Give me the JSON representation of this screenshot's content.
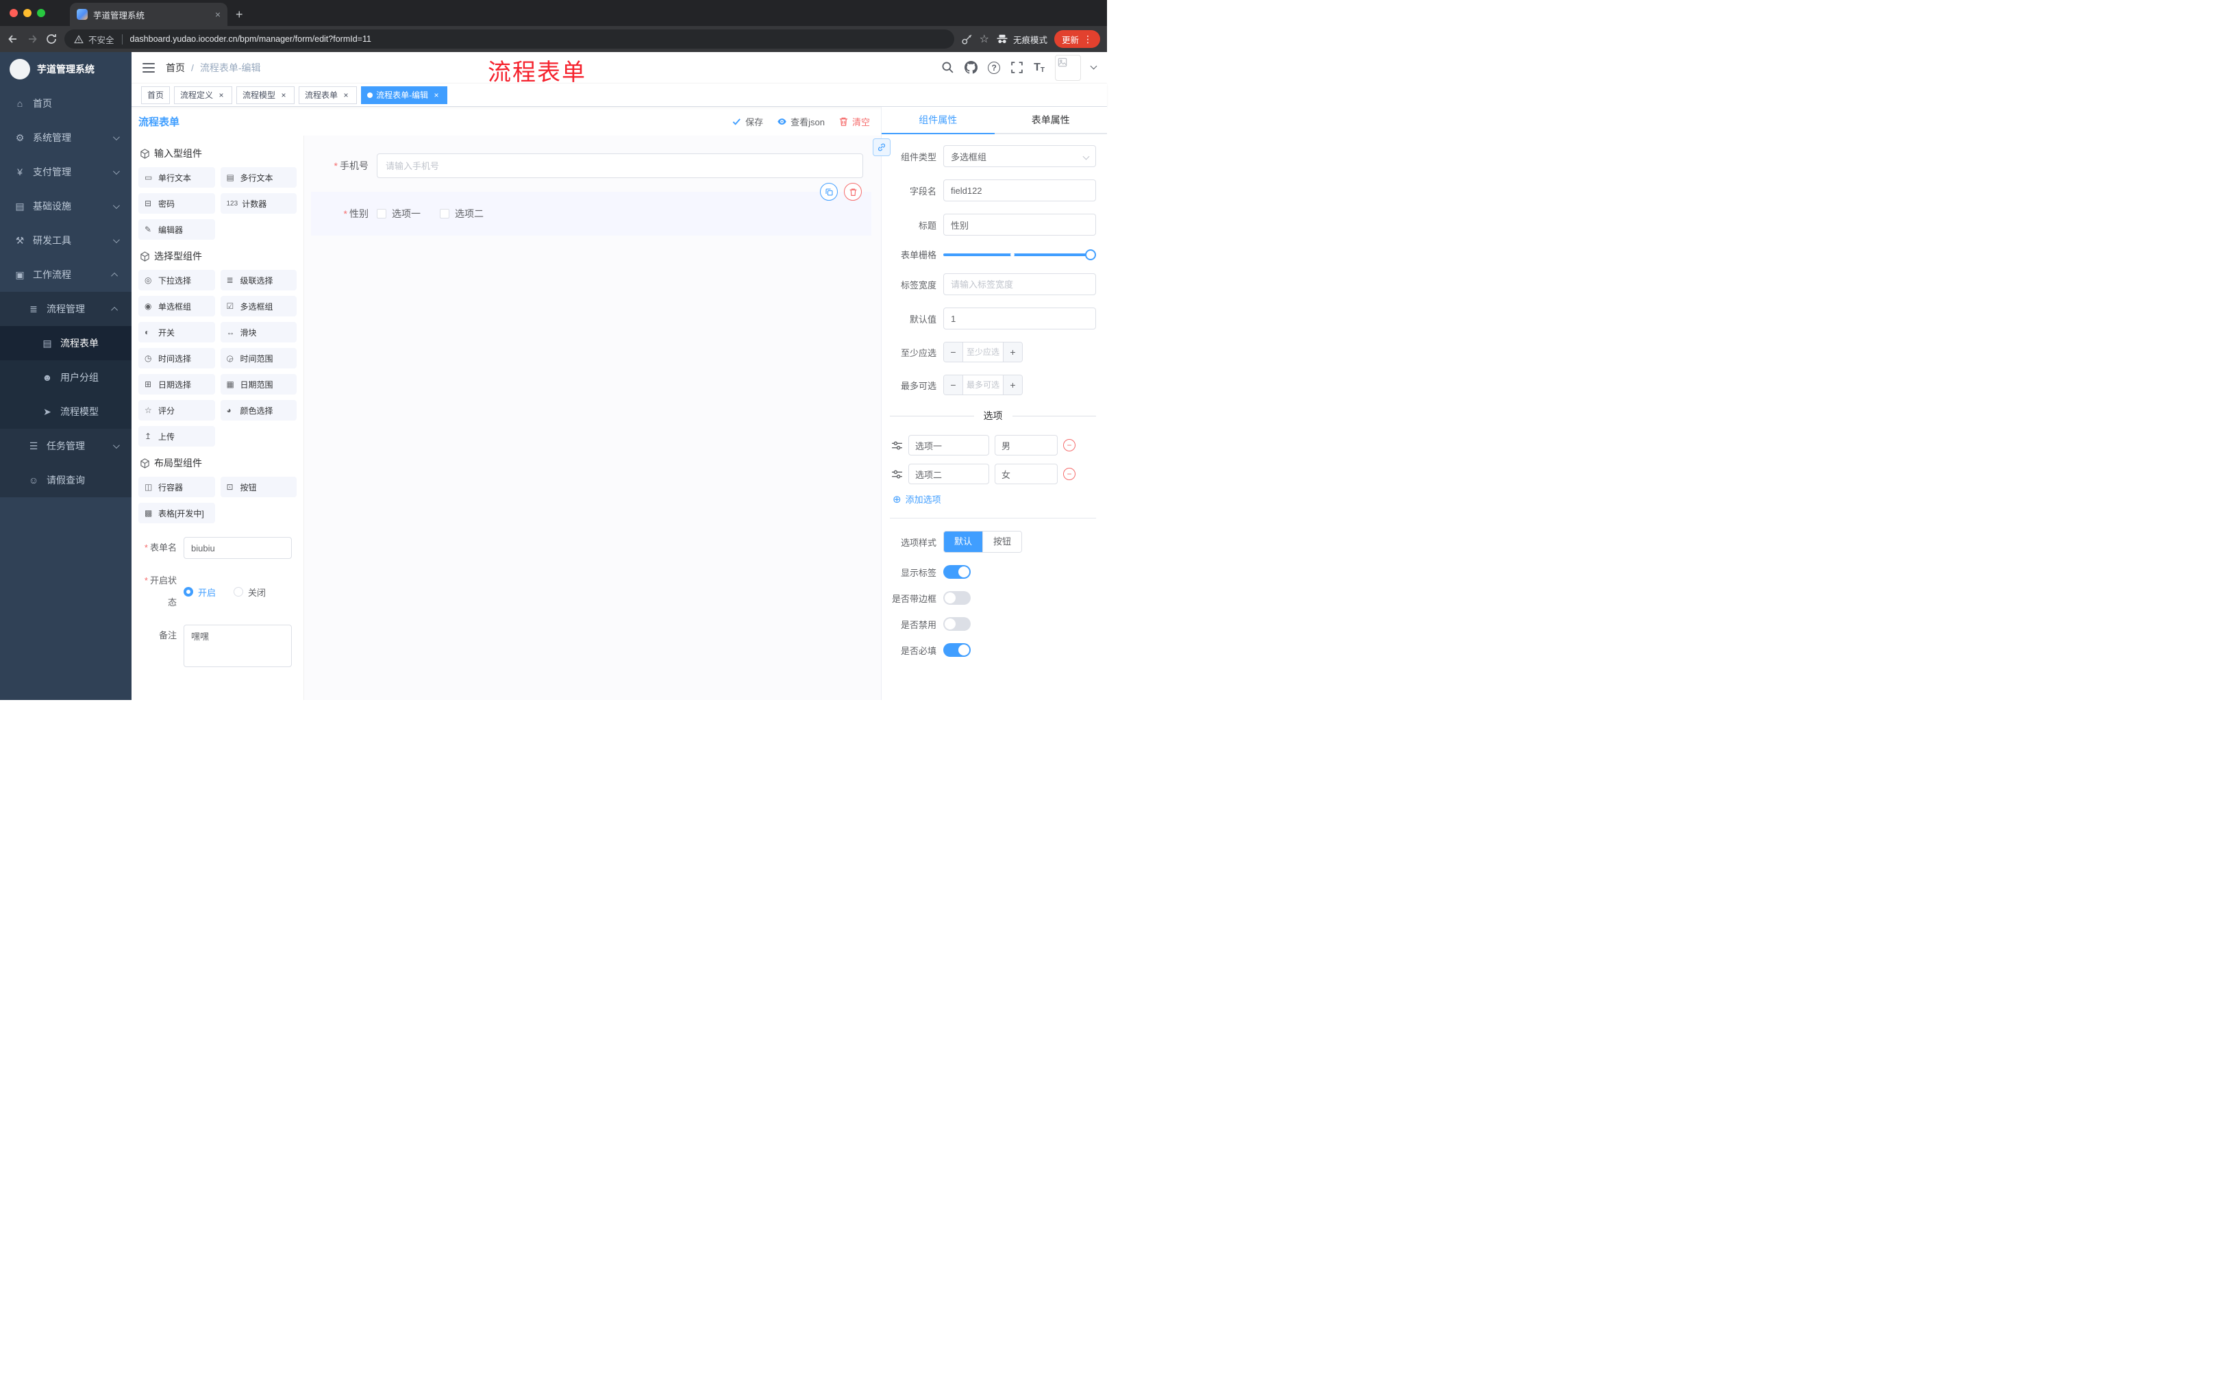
{
  "browser": {
    "tab_title": "芋道管理系统",
    "security_label": "不安全",
    "url": "dashboard.yudao.iocoder.cn/bpm/manager/form/edit?formId=11",
    "incognito_label": "无痕模式",
    "update_label": "更新"
  },
  "colors": {
    "accent": "#409eff",
    "danger": "#f56c6c",
    "annotation": "#f5222d",
    "update_pill": "#e2412e"
  },
  "sidebar": {
    "app_title": "芋道管理系统",
    "items": [
      {
        "label": "首页",
        "icon": "⌂"
      },
      {
        "label": "系统管理",
        "icon": "⚙"
      },
      {
        "label": "支付管理",
        "icon": "¥"
      },
      {
        "label": "基础设施",
        "icon": "▤"
      },
      {
        "label": "研发工具",
        "icon": "⚒"
      },
      {
        "label": "工作流程",
        "icon": "▣"
      },
      {
        "label": "流程管理",
        "icon": "≣"
      },
      {
        "label": "流程表单",
        "icon": "▤",
        "active": true
      },
      {
        "label": "用户分组",
        "icon": "☻"
      },
      {
        "label": "流程模型",
        "icon": "➤"
      },
      {
        "label": "任务管理",
        "icon": "☰"
      },
      {
        "label": "请假查询",
        "icon": "☺"
      }
    ]
  },
  "navbar": {
    "breadcrumb": [
      "首页",
      "流程表单-编辑"
    ],
    "separator": "/",
    "annotation": "流程表单"
  },
  "tags_view": {
    "tags": [
      {
        "label": "首页",
        "closable": false,
        "active": false
      },
      {
        "label": "流程定义",
        "closable": true,
        "active": false
      },
      {
        "label": "流程模型",
        "closable": true,
        "active": false
      },
      {
        "label": "流程表单",
        "closable": true,
        "active": false
      },
      {
        "label": "流程表单-编辑",
        "closable": true,
        "active": true
      }
    ]
  },
  "designer": {
    "panel_title": "流程表单",
    "toolbar": {
      "save": "保存",
      "view_json": "查看json",
      "clear": "清空"
    },
    "palette": {
      "sections": [
        {
          "title": "输入型组件",
          "items": [
            {
              "icon": "▭",
              "label": "单行文本"
            },
            {
              "icon": "▤",
              "label": "多行文本"
            },
            {
              "icon": "⊟",
              "label": "密码"
            },
            {
              "icon": "123",
              "label": "计数器"
            },
            {
              "icon": "✎",
              "label": "编辑器"
            }
          ]
        },
        {
          "title": "选择型组件",
          "items": [
            {
              "icon": "◎",
              "label": "下拉选择"
            },
            {
              "icon": "≣",
              "label": "级联选择"
            },
            {
              "icon": "◉",
              "label": "单选框组"
            },
            {
              "icon": "☑",
              "label": "多选框组"
            },
            {
              "icon": "◐",
              "label": "开关"
            },
            {
              "icon": "↔",
              "label": "滑块"
            },
            {
              "icon": "◷",
              "label": "时间选择"
            },
            {
              "icon": "◶",
              "label": "时间范围"
            },
            {
              "icon": "⊞",
              "label": "日期选择"
            },
            {
              "icon": "▦",
              "label": "日期范围"
            },
            {
              "icon": "☆",
              "label": "评分"
            },
            {
              "icon": "◕",
              "label": "颜色选择"
            },
            {
              "icon": "↥",
              "label": "上传"
            }
          ]
        },
        {
          "title": "布局型组件",
          "items": [
            {
              "icon": "◫",
              "label": "行容器"
            },
            {
              "icon": "⊡",
              "label": "按钮"
            },
            {
              "icon": "▩",
              "label": "表格[开发中]"
            }
          ]
        }
      ]
    },
    "meta_form": {
      "name_label": "表单名",
      "name_value": "biubiu",
      "status_label": "开启状态",
      "status_on": "开启",
      "status_off": "关闭",
      "status_selected": "开启",
      "remark_label": "备注",
      "remark_value": "嘿嘿"
    },
    "canvas": {
      "phone_field": {
        "label": "手机号",
        "placeholder": "请输入手机号"
      },
      "gender_field": {
        "label": "性别",
        "options": [
          "选项一",
          "选项二"
        ]
      }
    }
  },
  "properties": {
    "tabs": [
      {
        "label": "组件属性",
        "active": true
      },
      {
        "label": "表单属性",
        "active": false
      }
    ],
    "component_type": {
      "label": "组件类型",
      "value": "多选框组"
    },
    "field_name": {
      "label": "字段名",
      "value": "field122"
    },
    "title": {
      "label": "标题",
      "value": "性别"
    },
    "grid": {
      "label": "表单栅格"
    },
    "label_width": {
      "label": "标签宽度",
      "placeholder": "请输入标签宽度"
    },
    "default_value": {
      "label": "默认值",
      "value": "1"
    },
    "min_select": {
      "label": "至少应选",
      "placeholder": "至少应选"
    },
    "max_select": {
      "label": "最多可选",
      "placeholder": "最多可选"
    },
    "options_title": "选项",
    "options": [
      {
        "label": "选项一",
        "value": "男"
      },
      {
        "label": "选项二",
        "value": "女"
      }
    ],
    "add_option_label": "添加选项",
    "option_style": {
      "label": "选项样式",
      "choices": [
        "默认",
        "按钮"
      ],
      "selected": "默认"
    },
    "switches": [
      {
        "label": "显示标签",
        "on": true
      },
      {
        "label": "是否带边框",
        "on": false
      },
      {
        "label": "是否禁用",
        "on": false
      },
      {
        "label": "是否必填",
        "on": true
      }
    ]
  }
}
